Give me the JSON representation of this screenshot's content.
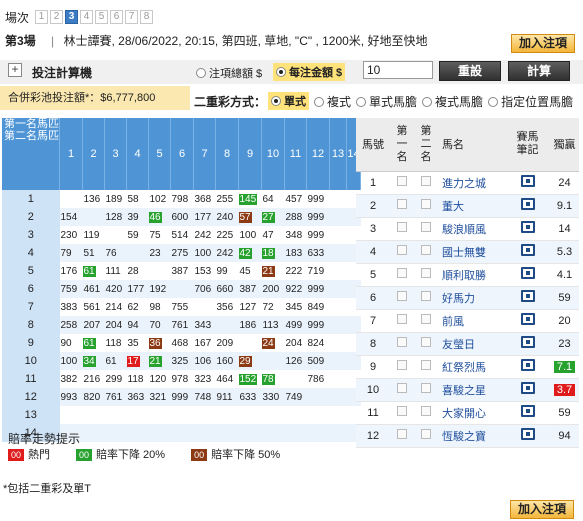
{
  "race_bar": {
    "label": "場次",
    "races": [
      "1",
      "2",
      "3",
      "4",
      "5",
      "6",
      "7",
      "8"
    ],
    "selected_index": 2
  },
  "race_info": {
    "race_label": "第3場",
    "details": "林士譚賽, 28/06/2022, 20:15, 第四班, 草地, \"C\" , 1200米, 好地至快地"
  },
  "add_bet_label": "加入注項",
  "calculator": {
    "title": "投注計算機",
    "opt_total": "注項總額 $",
    "opt_each": "每注金額 $",
    "amount": "10",
    "reset_label": "重設",
    "calc_label": "計算"
  },
  "pool": "合併彩池投注額*：$6,777,800",
  "qtype": {
    "title": "二重彩方式：",
    "options": [
      "單式",
      "複式",
      "單式馬膽",
      "複式馬膽",
      "指定位置馬膽"
    ],
    "selected_index": 0
  },
  "matrix": {
    "corner_top": "第一名馬匹",
    "corner_bottom": "第二名馬匹",
    "cols": [
      "1",
      "2",
      "3",
      "4",
      "5",
      "6",
      "7",
      "8",
      "9",
      "10",
      "11",
      "12",
      "13",
      "14"
    ],
    "rows": [
      {
        "n": "1",
        "cells": [
          "",
          "136",
          "189",
          "58",
          "102",
          "798",
          "368",
          "255",
          "145",
          "64",
          "457",
          "999",
          "",
          ""
        ],
        "hl": {
          "8": "g"
        }
      },
      {
        "n": "2",
        "cells": [
          "154",
          "",
          "128",
          "39",
          "46",
          "600",
          "177",
          "240",
          "57",
          "27",
          "288",
          "999",
          "",
          ""
        ],
        "hl": {
          "4": "g",
          "8": "b",
          "9": "g"
        }
      },
      {
        "n": "3",
        "cells": [
          "230",
          "119",
          "",
          "59",
          "75",
          "514",
          "242",
          "225",
          "100",
          "47",
          "348",
          "999",
          "",
          ""
        ],
        "hl": {}
      },
      {
        "n": "4",
        "cells": [
          "79",
          "51",
          "76",
          "",
          "23",
          "275",
          "100",
          "242",
          "42",
          "18",
          "183",
          "633",
          "",
          ""
        ],
        "hl": {
          "8": "g",
          "9": "g"
        }
      },
      {
        "n": "5",
        "cells": [
          "176",
          "61",
          "111",
          "28",
          "",
          "387",
          "153",
          "99",
          "45",
          "21",
          "222",
          "719",
          "",
          ""
        ],
        "hl": {
          "1": "g",
          "9": "b"
        }
      },
      {
        "n": "6",
        "cells": [
          "759",
          "461",
          "420",
          "177",
          "192",
          "",
          "706",
          "660",
          "387",
          "200",
          "922",
          "999",
          "",
          ""
        ],
        "hl": {}
      },
      {
        "n": "7",
        "cells": [
          "383",
          "561",
          "214",
          "62",
          "98",
          "755",
          "",
          "356",
          "127",
          "72",
          "345",
          "849",
          "",
          ""
        ],
        "hl": {}
      },
      {
        "n": "8",
        "cells": [
          "258",
          "207",
          "204",
          "94",
          "70",
          "761",
          "343",
          "",
          "186",
          "113",
          "499",
          "999",
          "",
          ""
        ],
        "hl": {}
      },
      {
        "n": "9",
        "cells": [
          "90",
          "61",
          "118",
          "35",
          "36",
          "468",
          "167",
          "209",
          "",
          "24",
          "204",
          "824",
          "",
          ""
        ],
        "hl": {
          "1": "g",
          "4": "b",
          "9": "b"
        }
      },
      {
        "n": "10",
        "cells": [
          "100",
          "34",
          "61",
          "17",
          "21",
          "325",
          "106",
          "160",
          "29",
          "",
          "126",
          "509",
          "",
          ""
        ],
        "hl": {
          "1": "g",
          "3": "r",
          "4": "g",
          "8": "b"
        }
      },
      {
        "n": "11",
        "cells": [
          "382",
          "216",
          "299",
          "118",
          "120",
          "978",
          "323",
          "464",
          "152",
          "78",
          "",
          "786",
          "",
          ""
        ],
        "hl": {
          "8": "g",
          "9": "g"
        }
      },
      {
        "n": "12",
        "cells": [
          "993",
          "820",
          "761",
          "363",
          "321",
          "999",
          "748",
          "911",
          "633",
          "330",
          "749",
          "",
          "",
          ""
        ],
        "hl": {}
      },
      {
        "n": "13",
        "cells": [
          "",
          "",
          "",
          "",
          "",
          "",
          "",
          "",
          "",
          "",
          "",
          "",
          "",
          ""
        ],
        "hl": {}
      },
      {
        "n": "14",
        "cells": [
          "",
          "",
          "",
          "",
          "",
          "",
          "",
          "",
          "",
          "",
          "",
          "",
          "",
          ""
        ],
        "hl": {}
      }
    ]
  },
  "horses": {
    "headers": {
      "no": "馬號",
      "first": "第一名",
      "second": "第二名",
      "name": "馬名",
      "notes": "賽馬筆記",
      "odds": "獨贏"
    },
    "rows": [
      {
        "no": "1",
        "name": "進力之城",
        "odds": "24",
        "o": ""
      },
      {
        "no": "2",
        "name": "董大",
        "odds": "9.1",
        "o": ""
      },
      {
        "no": "3",
        "name": "駿浪順風",
        "odds": "14",
        "o": ""
      },
      {
        "no": "4",
        "name": "國士無雙",
        "odds": "5.3",
        "o": ""
      },
      {
        "no": "5",
        "name": "順利取勝",
        "odds": "4.1",
        "o": ""
      },
      {
        "no": "6",
        "name": "好馬力",
        "odds": "59",
        "o": ""
      },
      {
        "no": "7",
        "name": "前風",
        "odds": "20",
        "o": ""
      },
      {
        "no": "8",
        "name": "友瑩日",
        "odds": "23",
        "o": ""
      },
      {
        "no": "9",
        "name": "紅祭烈馬",
        "odds": "7.1",
        "o": "g"
      },
      {
        "no": "10",
        "name": "喜駿之星",
        "odds": "3.7",
        "o": "r"
      },
      {
        "no": "11",
        "name": "大家開心",
        "odds": "59",
        "o": ""
      },
      {
        "no": "12",
        "name": "恆駿之寶",
        "odds": "94",
        "o": ""
      }
    ]
  },
  "legend": {
    "title": "賠率走勢提示",
    "items": [
      {
        "code": "00",
        "label": "熱門",
        "color": "#e01b1b"
      },
      {
        "code": "00",
        "label": "賠率下降 20%",
        "color": "#27a22e"
      },
      {
        "code": "00",
        "label": "賠率下降 50%",
        "color": "#8b3a14"
      }
    ]
  },
  "footnote": "*包括二重彩及單T"
}
